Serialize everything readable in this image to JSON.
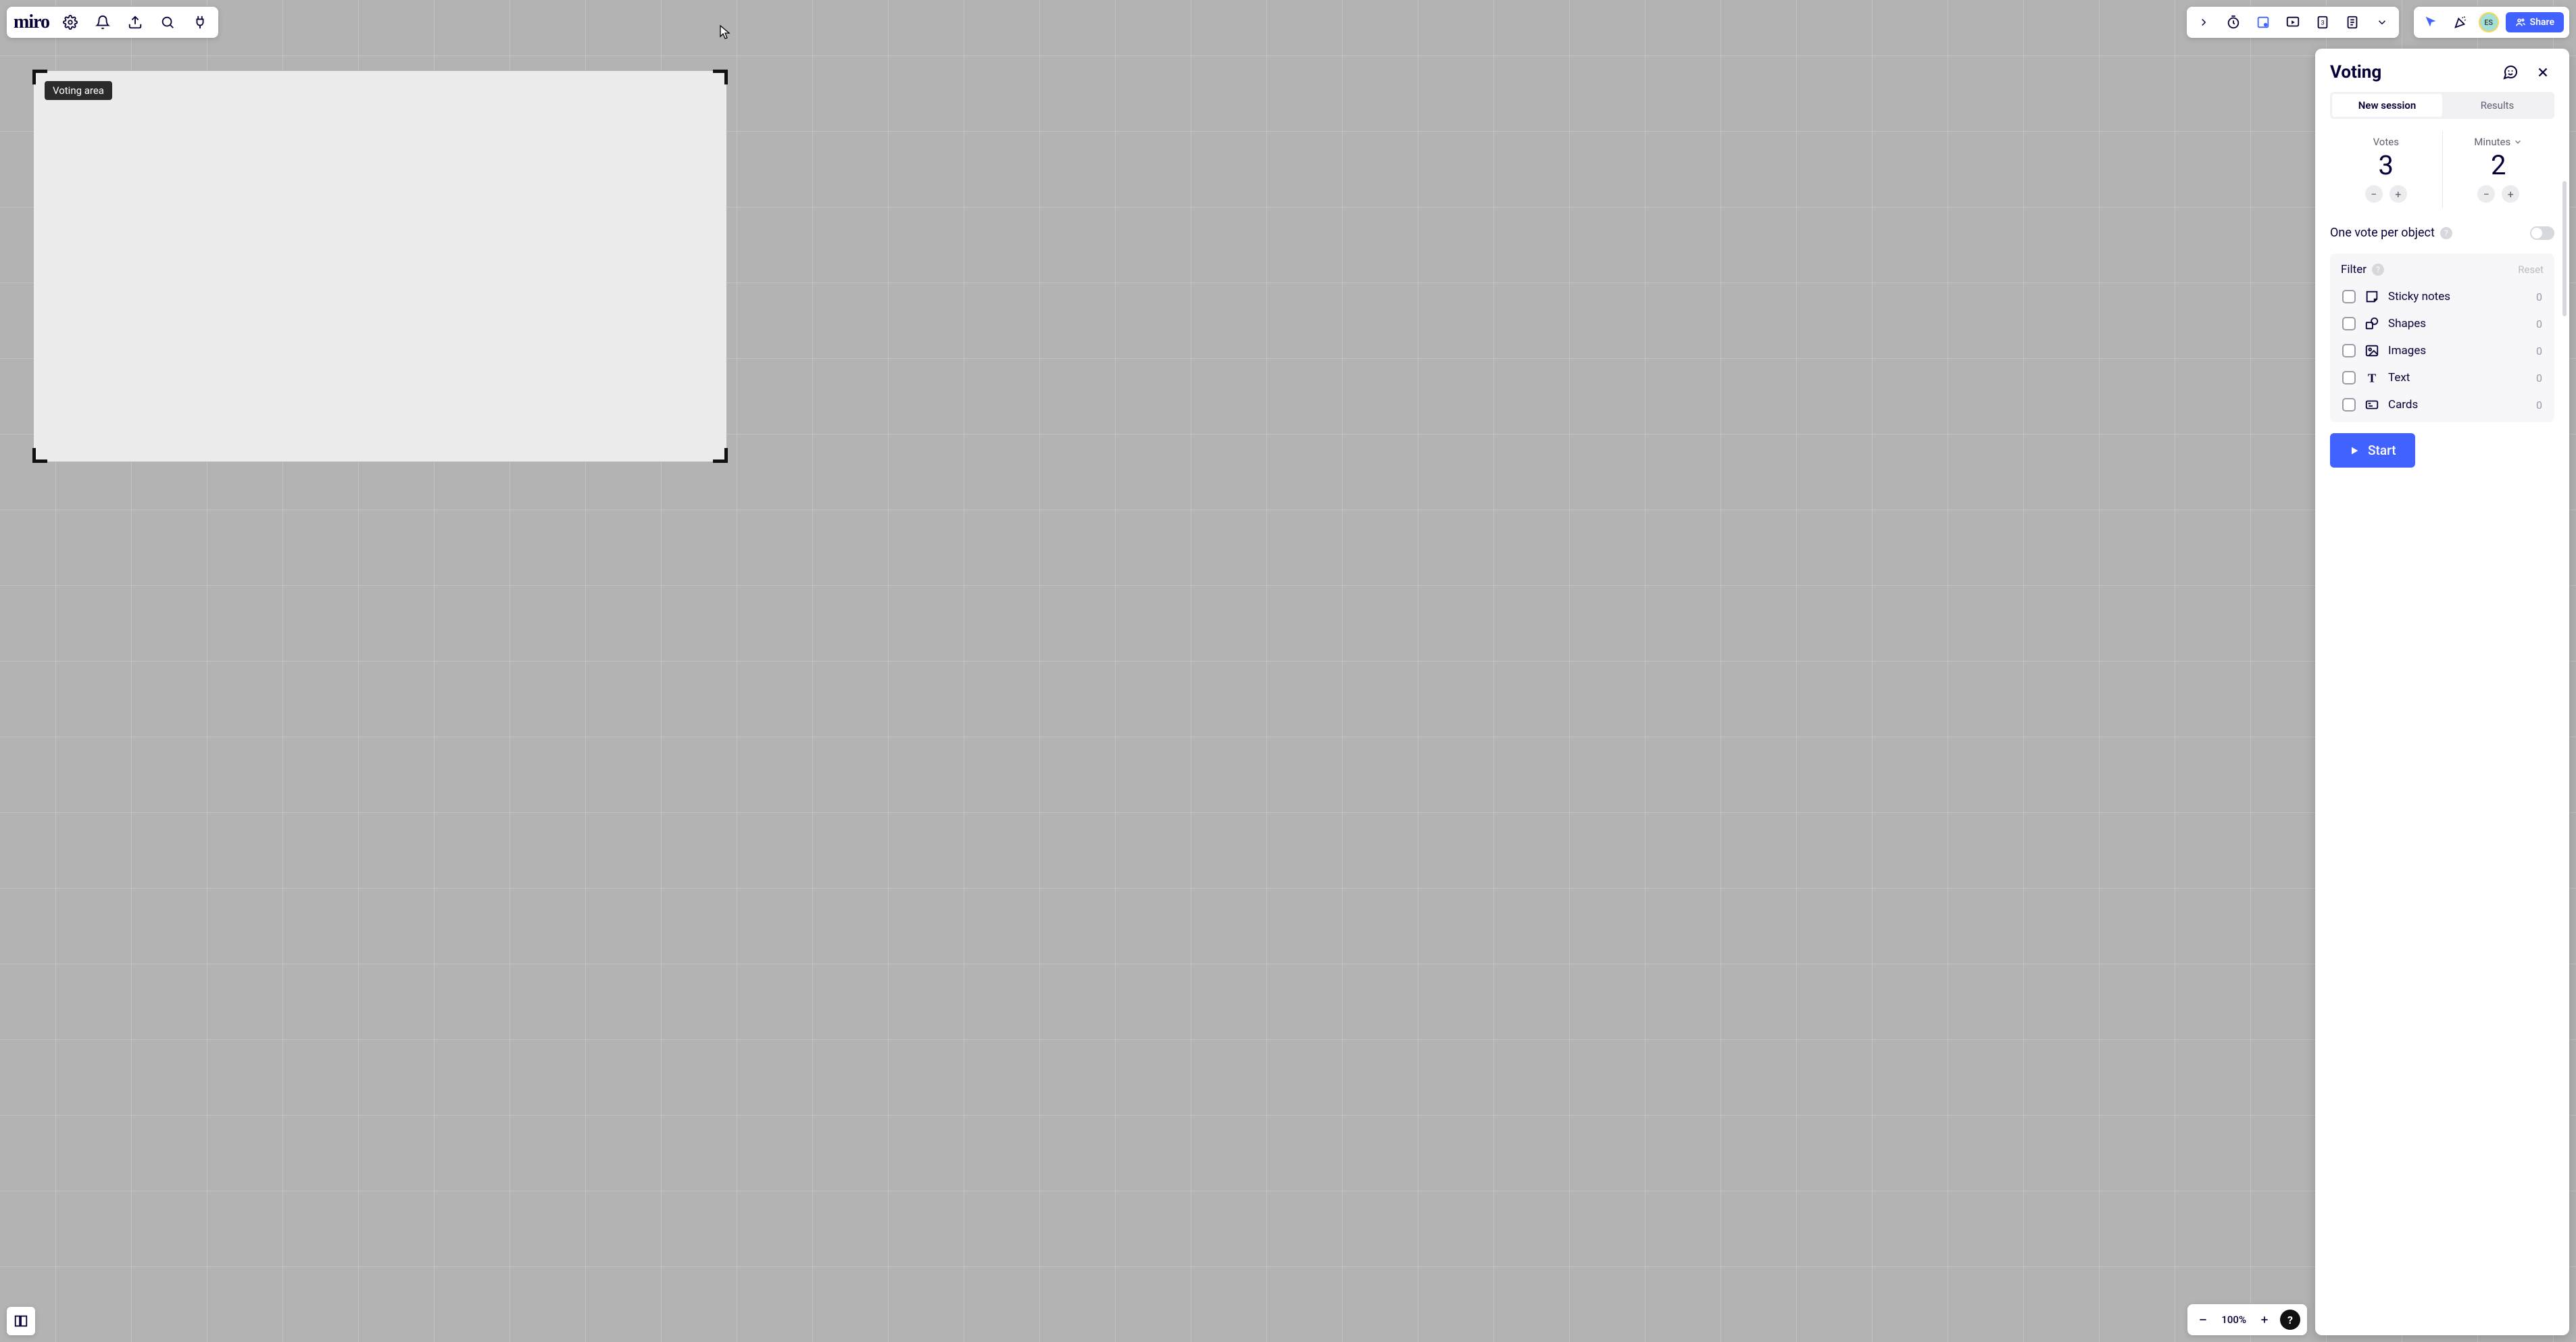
{
  "app": {
    "logo": "miro"
  },
  "canvas_label": "Voting area",
  "share": {
    "label": "Share"
  },
  "avatar": {
    "initials": "ES"
  },
  "zoom": {
    "percent": "100%"
  },
  "panel": {
    "title": "Voting",
    "tabs": {
      "new_session": "New session",
      "results": "Results"
    },
    "votes": {
      "label": "Votes",
      "value": "3"
    },
    "minutes": {
      "label": "Minutes",
      "value": "2"
    },
    "one_vote": {
      "label": "One vote per object"
    },
    "filter": {
      "title": "Filter",
      "reset": "Reset",
      "items": [
        {
          "name": "Sticky notes",
          "count": "0"
        },
        {
          "name": "Shapes",
          "count": "0"
        },
        {
          "name": "Images",
          "count": "0"
        },
        {
          "name": "Text",
          "count": "0"
        },
        {
          "name": "Cards",
          "count": "0"
        }
      ]
    },
    "start": "Start"
  }
}
